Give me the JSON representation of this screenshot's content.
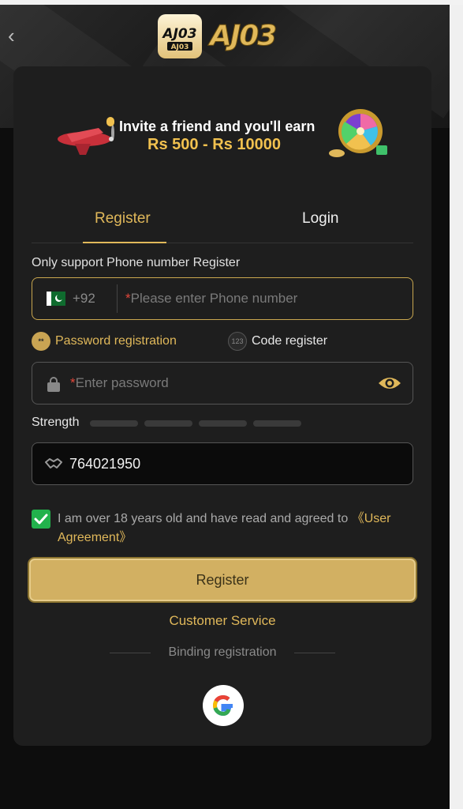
{
  "banner": {
    "invite_text": "Invite a friend and you'll earn",
    "amount_text": "Rs 500 - Rs 10000"
  },
  "tabs": [
    {
      "label": "Register",
      "active": true
    },
    {
      "label": "Login",
      "active": false
    }
  ],
  "form": {
    "support_text": "Only support Phone number Register",
    "country_code": "+92",
    "required_mark": "*",
    "phone_placeholder": "Please enter Phone number",
    "options": {
      "password_label": "Password registration",
      "password_icon_text": "**",
      "code_label": "Code register",
      "code_icon_text": "123"
    },
    "password_placeholder": "Enter password",
    "strength_label": "Strength",
    "invite_code_value": "764021950",
    "agreement_text": "I am over 18 years old and have read and agreed to ",
    "agreement_link": "《User Agreement》",
    "agreement_checked": true,
    "register_button": "Register"
  },
  "footer": {
    "customer_service": "Customer Service",
    "binding_label": "Binding registration"
  },
  "colors": {
    "accent": "#e0b85a",
    "button": "#d2b062",
    "check": "#22b24c"
  }
}
